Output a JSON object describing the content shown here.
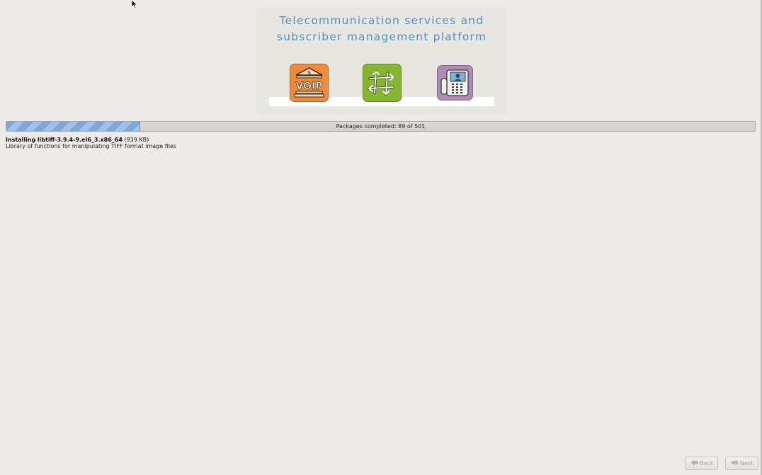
{
  "banner": {
    "title_line1": "Telecommunication services and",
    "title_line2": "subscriber management platform",
    "icons": [
      "voip-bank-icon",
      "route-arrows-icon",
      "videophone-icon"
    ],
    "voip_label": "VOIP",
    "colors": {
      "title": "#4f8fc4",
      "voip_tile": "#ef8a3a",
      "route_tile": "#86b52f",
      "phone_tile": "#b08ab7"
    }
  },
  "progress": {
    "completed": 89,
    "total": 501,
    "label": "Packages completed: 89 of 501",
    "fill_color": "#7fa6d8"
  },
  "current_package": {
    "prefix": "Installing",
    "name": "libtiff-3.9.4-9.el6_3.x86_64",
    "size": "(939 KB)",
    "description": "Library of functions for manipulating TIFF format image files"
  },
  "buttons": {
    "back_label": "Back",
    "next_label": "Next"
  }
}
